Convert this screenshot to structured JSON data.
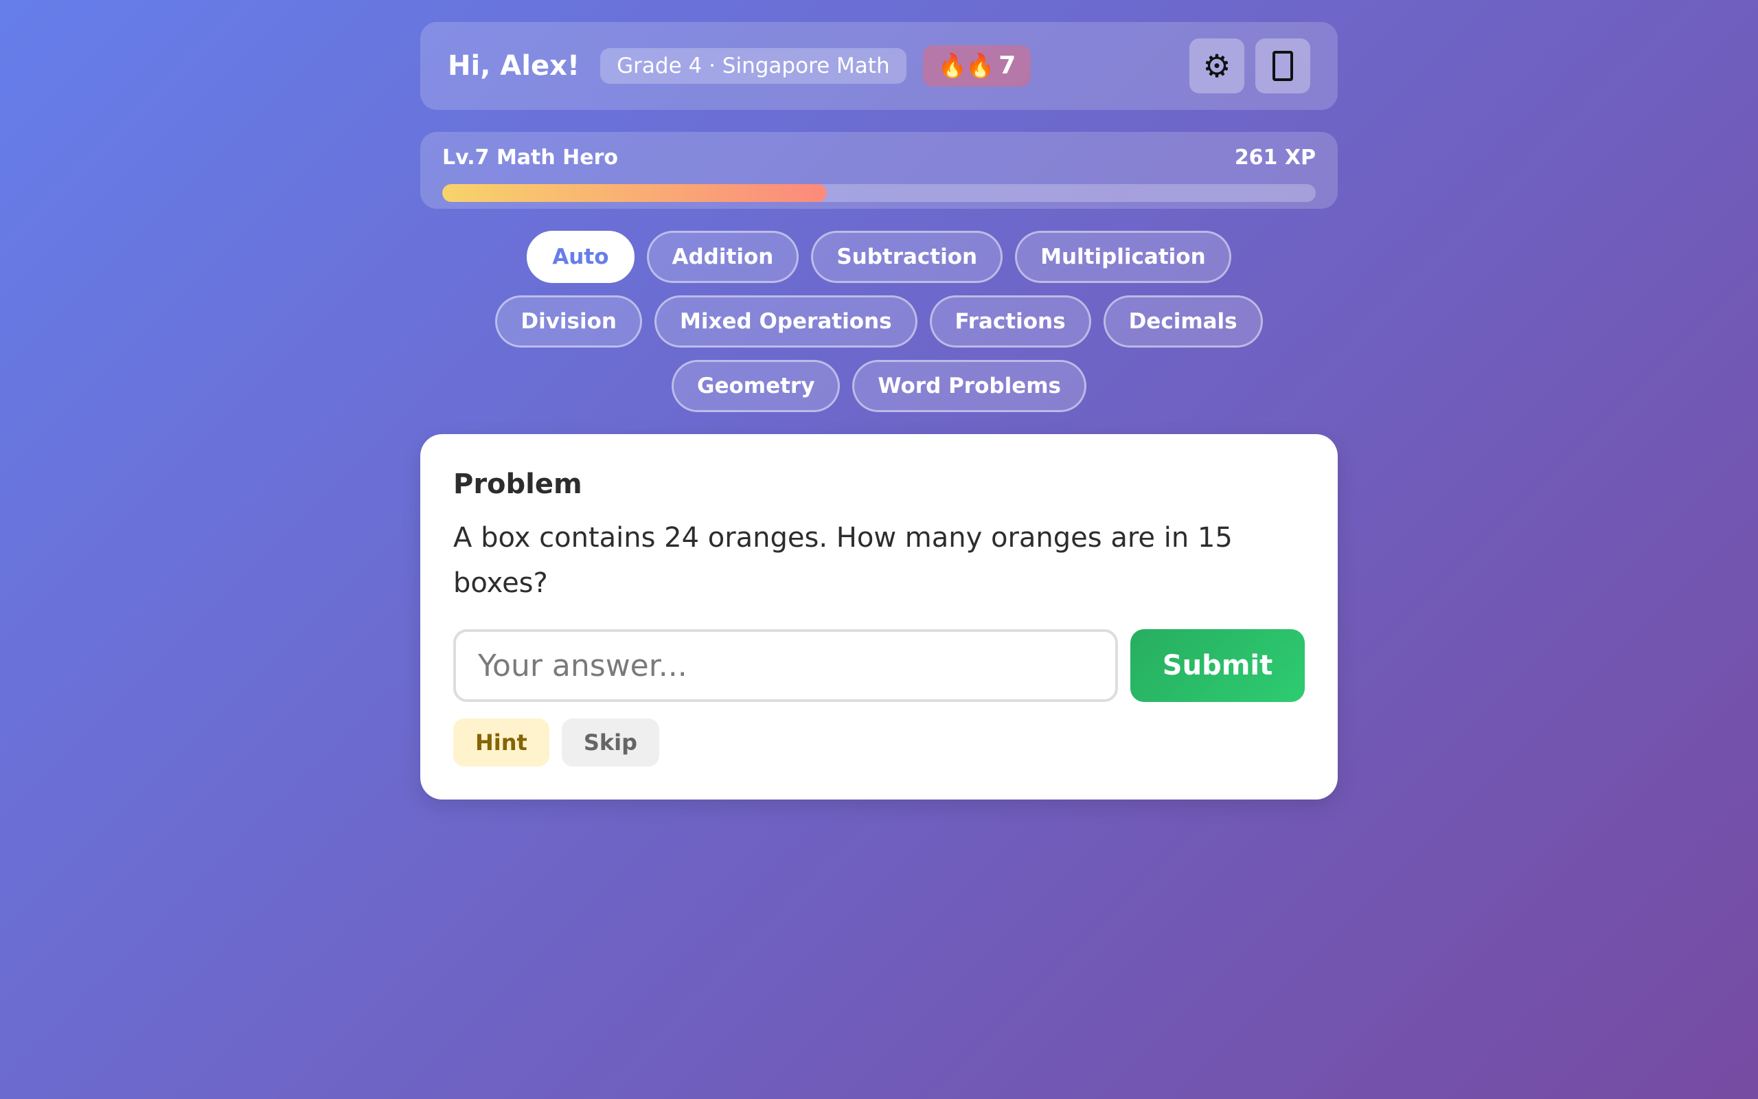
{
  "header": {
    "greeting": "Hi, Alex!",
    "grade_label": "Grade 4 · Singapore Math",
    "streak_icon": "🔥🔥",
    "streak_count": "7",
    "settings_icon": "⚙",
    "stats_icon_name": "clipboard-icon"
  },
  "progress": {
    "level_label": "Lv.7 Math Hero",
    "xp_label": "261 XP",
    "xp_fraction": 0.44
  },
  "topics": {
    "items": [
      {
        "label": "Auto",
        "active": true
      },
      {
        "label": "Addition",
        "active": false
      },
      {
        "label": "Subtraction",
        "active": false
      },
      {
        "label": "Multiplication",
        "active": false
      },
      {
        "label": "Division",
        "active": false
      },
      {
        "label": "Mixed Operations",
        "active": false
      },
      {
        "label": "Fractions",
        "active": false
      },
      {
        "label": "Decimals",
        "active": false
      },
      {
        "label": "Geometry",
        "active": false
      },
      {
        "label": "Word Problems",
        "active": false
      }
    ]
  },
  "problem": {
    "title": "Problem",
    "text": "A box contains 24 oranges. How many oranges are in 15 boxes?",
    "answer_value": "",
    "answer_placeholder": "Your answer...",
    "submit_label": "Submit",
    "hint_label": "Hint",
    "skip_label": "Skip"
  },
  "colors": {
    "accent": "#667eea",
    "submit_green": "#27ae60",
    "hint_bg": "#fff3cd",
    "hint_text": "#856404"
  }
}
